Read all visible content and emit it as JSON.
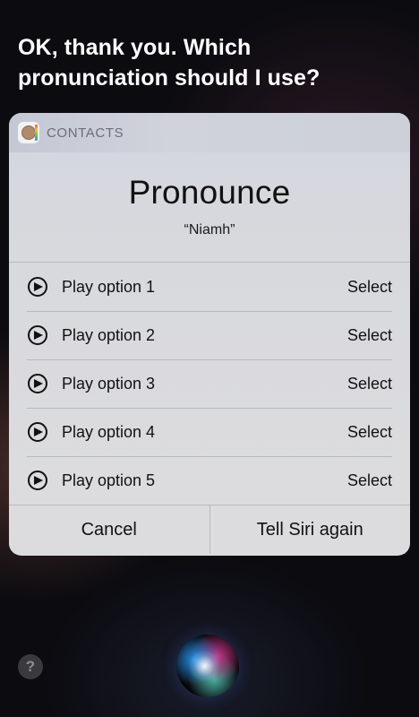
{
  "siri": {
    "prompt": "OK, thank you. Which pronunciation should I use?"
  },
  "card": {
    "app_name": "CONTACTS",
    "app_icon": "contacts-app-icon",
    "title": "Pronounce",
    "subtitle": "“Niamh”",
    "options": [
      {
        "label": "Play option 1",
        "action": "Select"
      },
      {
        "label": "Play option 2",
        "action": "Select"
      },
      {
        "label": "Play option 3",
        "action": "Select"
      },
      {
        "label": "Play option 4",
        "action": "Select"
      },
      {
        "label": "Play option 5",
        "action": "Select"
      }
    ],
    "cancel_label": "Cancel",
    "retry_label": "Tell Siri again"
  },
  "footer": {
    "help_label": "?",
    "help_icon": "question-mark-icon",
    "siri_icon": "siri-orb-icon"
  },
  "colors": {
    "background": "#0b0b10",
    "card": "#dcdcde",
    "text": "#111111",
    "header_text": "#6e6e73"
  }
}
